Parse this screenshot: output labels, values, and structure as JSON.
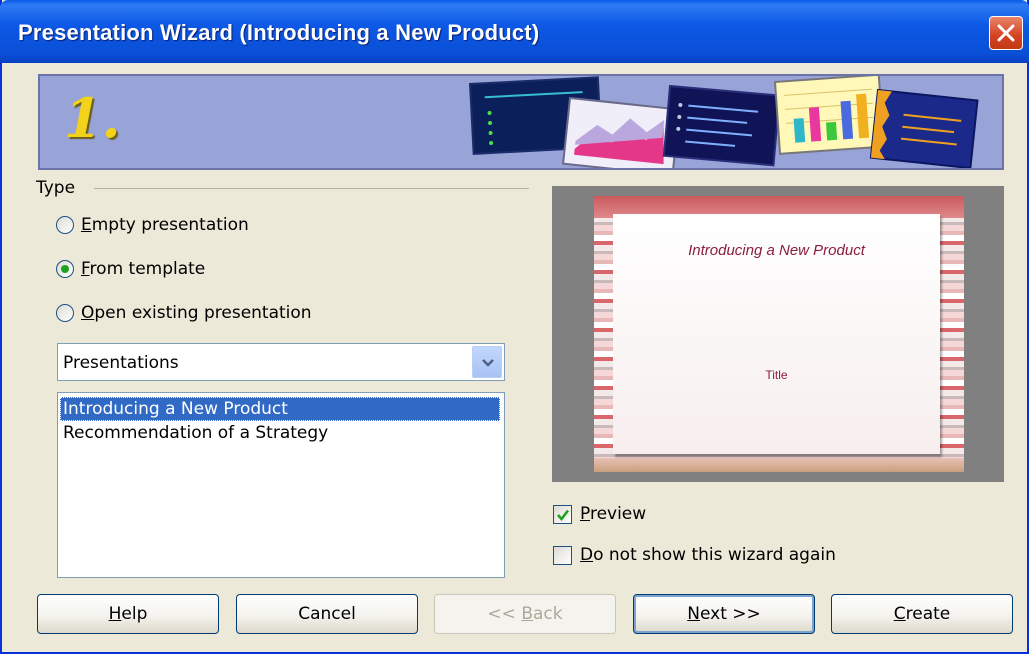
{
  "window": {
    "title": "Presentation Wizard (Introducing a New Product)"
  },
  "banner": {
    "step": "1."
  },
  "type_group": {
    "label": "Type",
    "options": [
      {
        "prefix": "",
        "accel": "E",
        "rest": "mpty presentation",
        "checked": false
      },
      {
        "prefix": "",
        "accel": "F",
        "rest": "rom template",
        "checked": true
      },
      {
        "prefix": "",
        "accel": "O",
        "rest": "pen existing presentation",
        "checked": false
      }
    ]
  },
  "category_select": {
    "value": "Presentations"
  },
  "template_list": {
    "items": [
      {
        "label": "Introducing a New Product",
        "selected": true
      },
      {
        "label": "Recommendation of a Strategy",
        "selected": false
      }
    ]
  },
  "preview": {
    "slide_title": "Introducing a New Product",
    "slide_subtitle": "Title"
  },
  "checkboxes": {
    "preview": {
      "prefix": "",
      "accel": "P",
      "rest": "review",
      "checked": true
    },
    "no_show": {
      "prefix": "",
      "accel": "D",
      "rest": "o not show this wizard again",
      "checked": false
    }
  },
  "buttons": {
    "help": {
      "prefix": "",
      "accel": "H",
      "rest": "elp"
    },
    "cancel": {
      "prefix": "Cancel",
      "accel": "",
      "rest": ""
    },
    "back": {
      "prefix": "<< ",
      "accel": "B",
      "rest": "ack"
    },
    "next": {
      "prefix": "",
      "accel": "N",
      "rest": "ext >>"
    },
    "create": {
      "prefix": "",
      "accel": "C",
      "rest": "reate"
    }
  }
}
